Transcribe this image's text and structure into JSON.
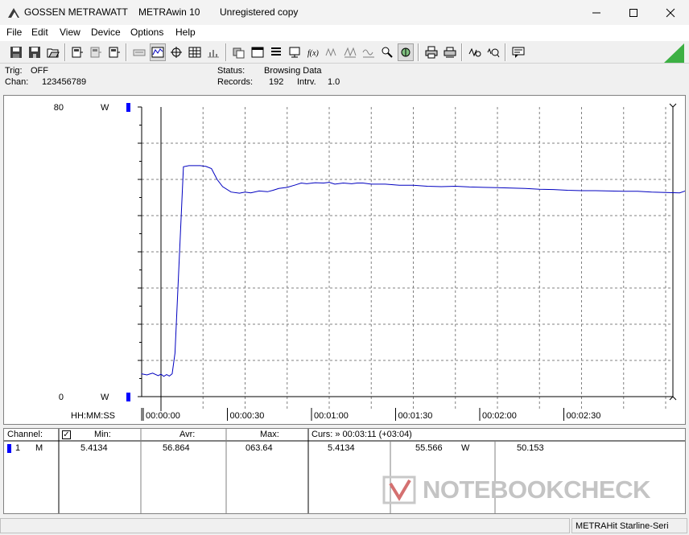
{
  "window": {
    "app_name": "GOSSEN METRAWATT",
    "product": "METRAwin 10",
    "registration": "Unregistered copy"
  },
  "menu": [
    {
      "label": "File"
    },
    {
      "label": "Edit"
    },
    {
      "label": "View"
    },
    {
      "label": "Device"
    },
    {
      "label": "Options"
    },
    {
      "label": "Help"
    }
  ],
  "toolbar": {
    "icons": [
      "save-icon",
      "save-as-icon",
      "open-icon",
      "device-1-icon",
      "device-2-icon",
      "device-3-icon",
      "keyboard-icon",
      "graph-view-icon",
      "cursor-icon",
      "table-view-icon",
      "histogram-icon",
      "copy-icon",
      "window-icon",
      "list-icon",
      "monitor-icon",
      "fx-icon",
      "waveform-1-icon",
      "waveform-2-icon",
      "waveform-3-icon",
      "zoom-icon",
      "trigger-icon",
      "print-icon",
      "print-preview-icon",
      "measure-icon",
      "search-icon",
      "message-icon"
    ]
  },
  "status": {
    "trig_label": "Trig:",
    "trig_value": "OFF",
    "chan_label": "Chan:",
    "chan_value": "123456789",
    "status_label": "Status:",
    "status_value": "Browsing Data",
    "records_label": "Records:",
    "records_value": "192",
    "intrv_label": "Intrv.",
    "intrv_value": "1.0"
  },
  "chart_data": {
    "type": "line",
    "y_unit": "W",
    "ylim": [
      0,
      80
    ],
    "y_tick_labels": [
      "80",
      "0"
    ],
    "x_axis_label": "HH:MM:SS",
    "x_tick_labels": [
      "00:00:00",
      "00:00:30",
      "00:01:00",
      "00:01:30",
      "00:02:00",
      "00:02:30"
    ],
    "grid": true,
    "series": [
      {
        "color": "#0000c0",
        "x": [
          -7,
          -5,
          -3,
          -1,
          0,
          1,
          2,
          3,
          4,
          5,
          8,
          10,
          12,
          14,
          16,
          18,
          20,
          22,
          25,
          28,
          30,
          32,
          35,
          38,
          40,
          42,
          45,
          48,
          50,
          52,
          55,
          58,
          60,
          62,
          65,
          68,
          70,
          72,
          75,
          78,
          80,
          85,
          90,
          95,
          100,
          105,
          110,
          115,
          120,
          125,
          130,
          135,
          140,
          145,
          150,
          155,
          160,
          165,
          170,
          175,
          180,
          185,
          187,
          190
        ],
        "y": [
          6.3,
          6.0,
          6.5,
          5.8,
          6.2,
          5.6,
          6.1,
          5.7,
          6.3,
          12.0,
          63.5,
          63.8,
          63.8,
          63.8,
          63.6,
          63.0,
          60.0,
          58.0,
          56.5,
          56.2,
          56.5,
          56.3,
          56.8,
          56.6,
          57.0,
          57.5,
          57.8,
          58.5,
          59.0,
          58.8,
          59.1,
          59.0,
          59.2,
          58.7,
          59.0,
          58.8,
          59.0,
          59.0,
          58.7,
          58.7,
          58.7,
          58.4,
          58.4,
          58.1,
          58.0,
          58.1,
          57.9,
          57.8,
          57.7,
          57.6,
          57.5,
          57.3,
          57.2,
          57.0,
          56.9,
          56.9,
          56.8,
          56.7,
          56.7,
          56.5,
          56.4,
          56.3,
          56.8,
          56.5
        ]
      }
    ]
  },
  "table": {
    "headers": {
      "channel": "Channel:",
      "min": "Min:",
      "avr": "Avr:",
      "max": "Max:",
      "curs": "Curs: » 00:03:11 (+03:04)"
    },
    "row": {
      "channel_num": "1",
      "channel_id": "M",
      "min": "5.4134",
      "avr": "56.864",
      "max": "063.64",
      "cursor_start": "5.4134",
      "cursor_end": "55.566",
      "unit": "W",
      "cursor_avg": "50.153"
    }
  },
  "watermark": "NOTEBOOKCHECK",
  "statusbar": {
    "device": "METRAHit Starline-Seri"
  },
  "colors": {
    "trace": "#0000c0",
    "grid": "#808080",
    "channel_marker": "#0000ff",
    "watermark": "#c0c0c0",
    "accent_triangle": "#3cb043"
  }
}
